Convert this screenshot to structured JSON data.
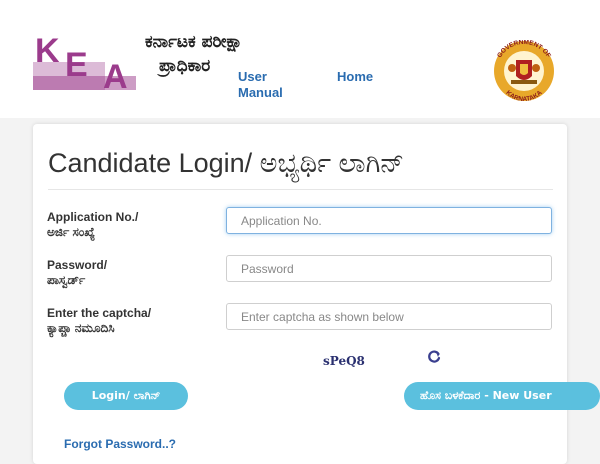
{
  "header": {
    "logo_letters": [
      "K",
      "E",
      "A"
    ],
    "org_name_line1": "ಕರ್ನಾಟಕ ಪರೀಕ್ಷಾ",
    "org_name_line2": "ಪ್ರಾಧಿಕಾರ",
    "nav": {
      "user_manual": "User Manual",
      "home": "Home"
    },
    "emblem_text_top": "GOVERNMENT OF",
    "emblem_text_bottom": "KARNATAKA"
  },
  "login": {
    "title": "Candidate Login/ ಅಭ್ಯರ್ಥಿ ಲಾಗಿನ್",
    "fields": [
      {
        "label_en": "Application No./",
        "label_kn": "ಅರ್ಜಿ ಸಂಖ್ಯೆ",
        "placeholder": "Application No.",
        "value": ""
      },
      {
        "label_en": "Password/",
        "label_kn": "ಪಾಸ್ವರ್ಡ್",
        "placeholder": "Password",
        "value": ""
      },
      {
        "label_en": "Enter the captcha/",
        "label_kn": "ಕ್ಯಾಪ್ಚಾ ನಮೂದಿಸಿ",
        "placeholder": "Enter captcha as shown below",
        "value": ""
      }
    ],
    "captcha": "sPeQ8",
    "refresh_icon": "refresh-icon",
    "login_button": "Login/ ಲಾಗಿನ್",
    "new_user_button": "ಹೊಸ ಬಳಕೆದಾರ - New User",
    "forgot_password": "Forgot Password..?"
  },
  "colors": {
    "logo_purple": "#9b3b8c",
    "link_blue": "#2a6cb0",
    "button_cyan": "#5bc0de",
    "emblem_gold": "#e8a82a",
    "emblem_red": "#b02020"
  }
}
